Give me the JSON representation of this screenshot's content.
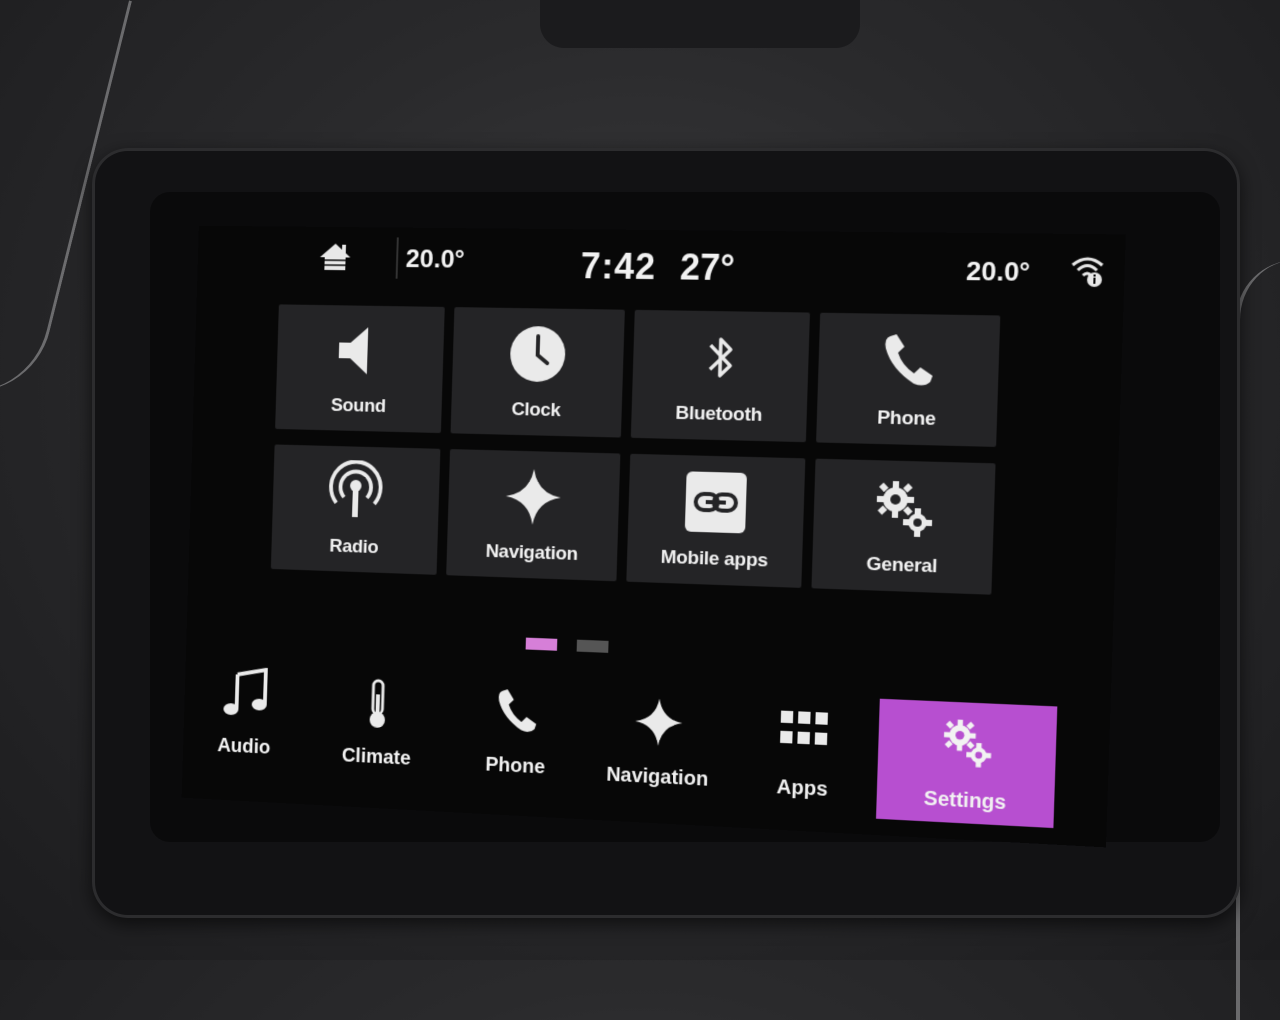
{
  "status_bar": {
    "driver_temp": "20.0°",
    "time": "7:42",
    "outside_temp": "27°",
    "passenger_temp": "20.0°",
    "home_icon": "home-icon",
    "wifi_icon": "wifi-info-icon"
  },
  "tiles": [
    {
      "label": "Sound",
      "icon": "speaker-icon"
    },
    {
      "label": "Clock",
      "icon": "clock-icon"
    },
    {
      "label": "Bluetooth",
      "icon": "bluetooth-icon"
    },
    {
      "label": "Phone",
      "icon": "phone-icon"
    },
    {
      "label": "Radio",
      "icon": "radio-antenna-icon"
    },
    {
      "label": "Navigation",
      "icon": "navigation-star-icon"
    },
    {
      "label": "Mobile apps",
      "icon": "link-icon"
    },
    {
      "label": "General",
      "icon": "gears-icon"
    }
  ],
  "pager": {
    "pages": 2,
    "current": 1
  },
  "nav_bar": [
    {
      "label": "Audio",
      "icon": "music-note-icon",
      "selected": false
    },
    {
      "label": "Climate",
      "icon": "thermometer-icon",
      "selected": false
    },
    {
      "label": "Phone",
      "icon": "phone-icon",
      "selected": false
    },
    {
      "label": "Navigation",
      "icon": "navigation-star-icon",
      "selected": false
    },
    {
      "label": "Apps",
      "icon": "apps-grid-icon",
      "selected": false
    },
    {
      "label": "Settings",
      "icon": "gears-icon",
      "selected": true
    }
  ],
  "colors": {
    "accent": "#b74fd0",
    "pager_active": "#d67fd8",
    "tile_bg": "#242426",
    "screen_bg": "#070707"
  }
}
